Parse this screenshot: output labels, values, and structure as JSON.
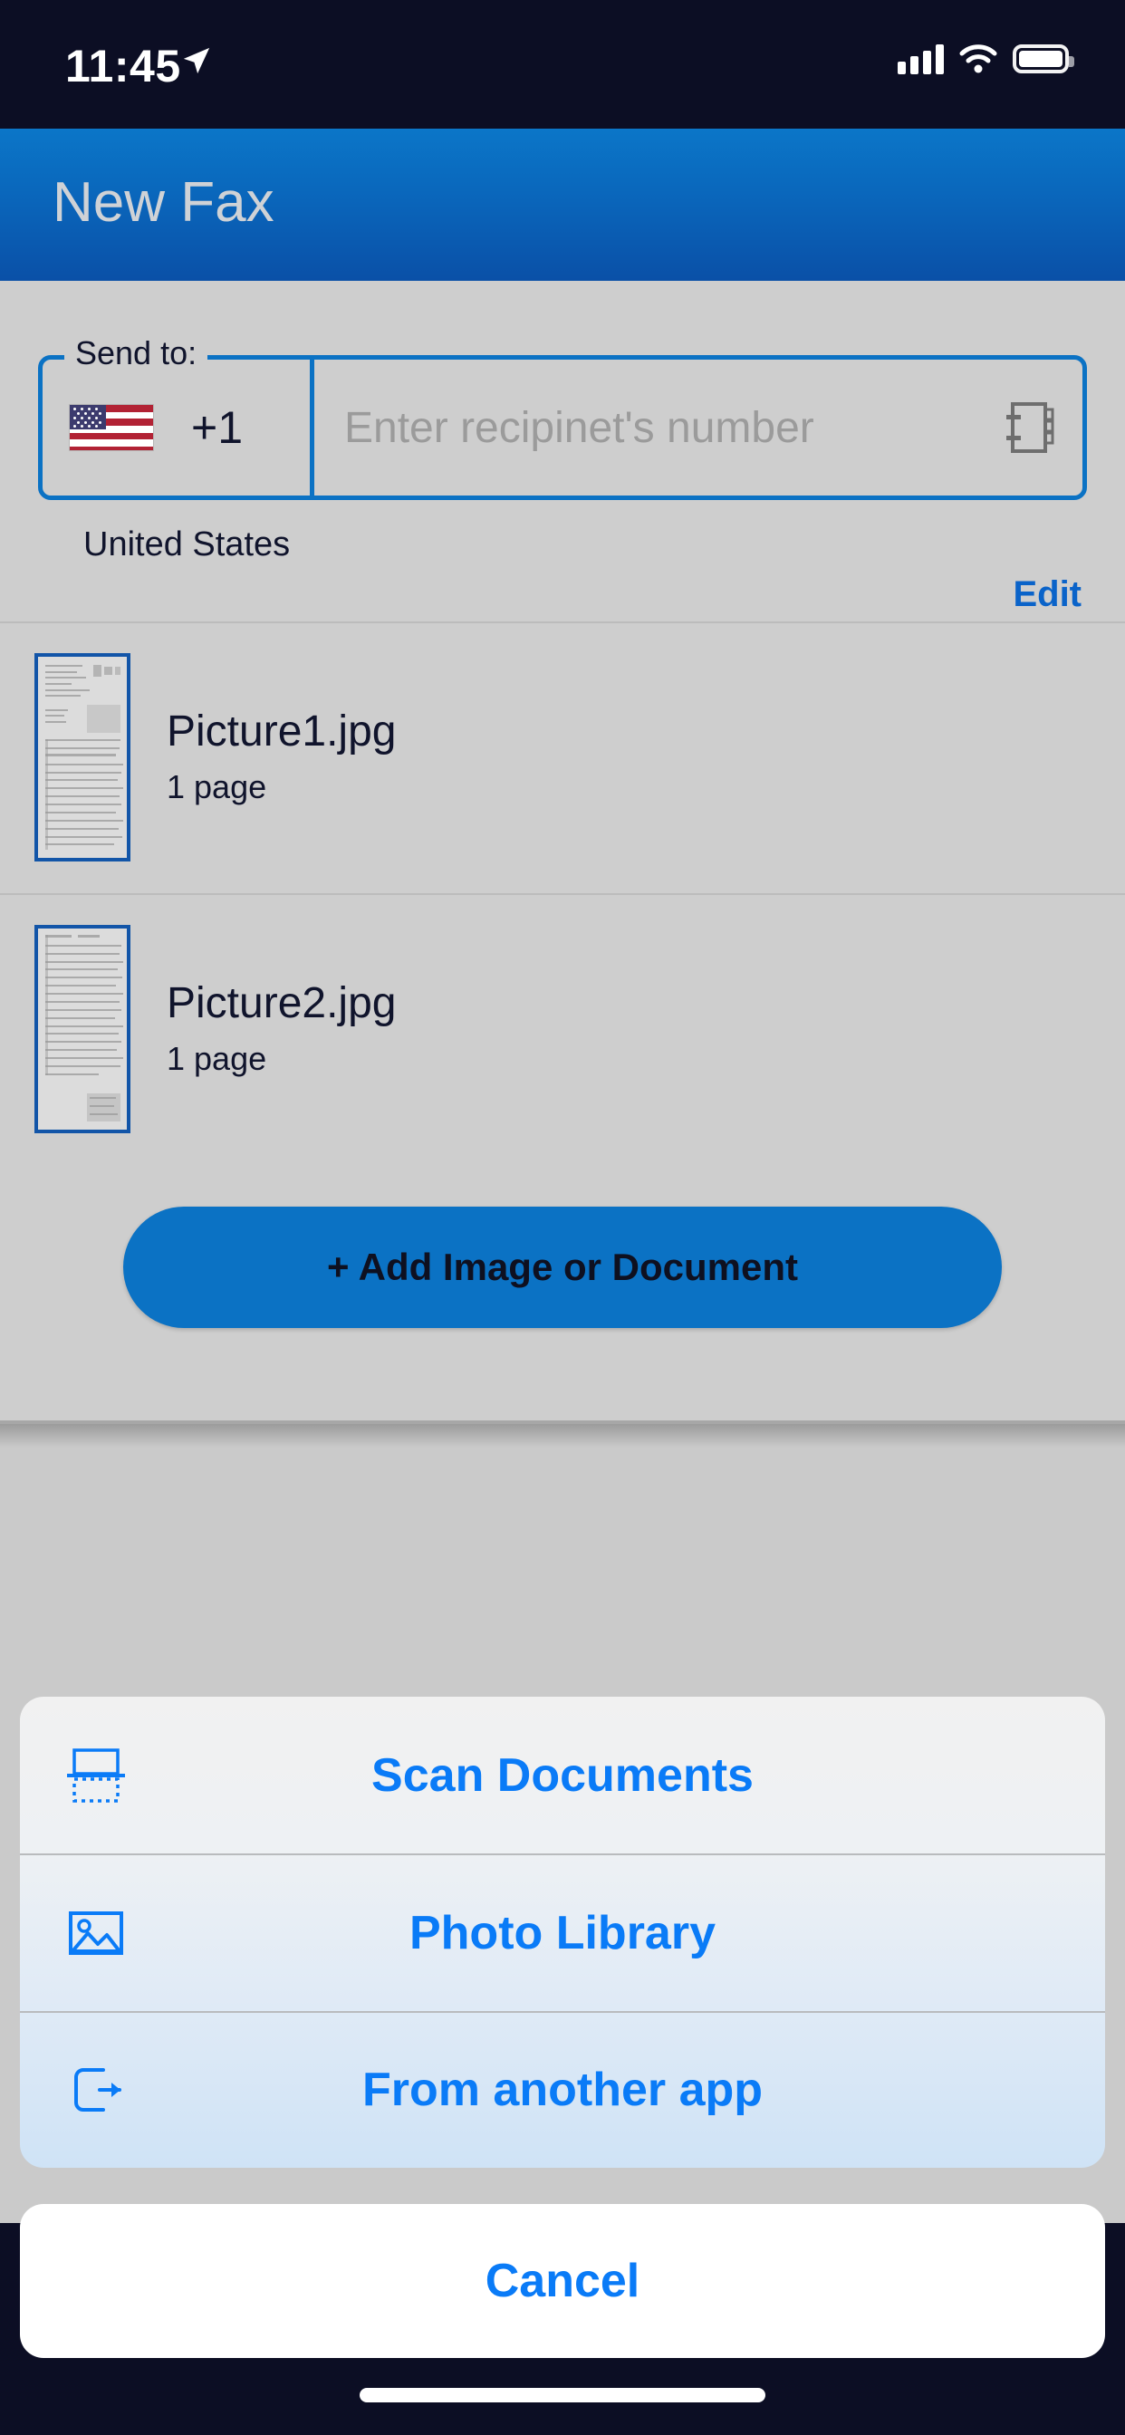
{
  "status_bar": {
    "time": "11:45",
    "location_icon": "location-arrow-icon",
    "signal_icon": "cellular-signal-icon",
    "wifi_icon": "wifi-icon",
    "battery_icon": "battery-icon"
  },
  "header": {
    "title": "New Fax"
  },
  "send_to": {
    "legend": "Send to:",
    "flag_icon": "us-flag-icon",
    "country_code": "+1",
    "number_value": "",
    "number_placeholder": "Enter recipinet's number",
    "contacts_icon": "address-book-icon",
    "country_name": "United States",
    "edit_label": "Edit"
  },
  "attachments": [
    {
      "name": "Picture1.jpg",
      "pages": "1 page",
      "thumbnail_icon": "document-thumbnail"
    },
    {
      "name": "Picture2.jpg",
      "pages": "1 page",
      "thumbnail_icon": "document-thumbnail"
    }
  ],
  "add_button": {
    "label": "+  Add Image or Document"
  },
  "action_sheet": {
    "options": [
      {
        "label": "Scan Documents",
        "icon": "scan-document-icon"
      },
      {
        "label": "Photo Library",
        "icon": "photo-library-icon"
      },
      {
        "label": "From another app",
        "icon": "open-in-external-app-icon"
      }
    ],
    "cancel_label": "Cancel"
  },
  "colors": {
    "brand_blue": "#0b72c4",
    "header_blue_dark": "#0a50a7",
    "link_blue": "#0a7bf7",
    "edit_blue": "#0a63c9",
    "page_gray": "#cecece",
    "status_bar_dark": "#0c0e24"
  }
}
